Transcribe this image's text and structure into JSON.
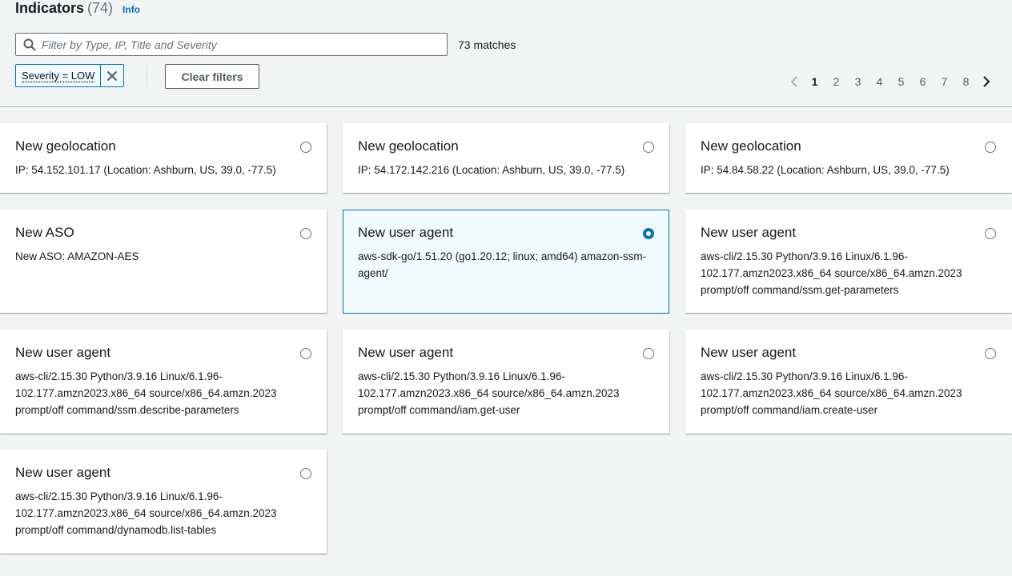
{
  "header": {
    "title": "Indicators",
    "count": "(74)",
    "info": "Info"
  },
  "search": {
    "placeholder": "Filter by Type, IP, Title and Severity",
    "matches": "73 matches"
  },
  "filter_token": {
    "label": "Severity = LOW"
  },
  "clear_filters": "Clear filters",
  "pagination": {
    "pages": [
      "1",
      "2",
      "3",
      "4",
      "5",
      "6",
      "7",
      "8"
    ],
    "current": "1"
  },
  "cards": [
    {
      "title": "New geolocation",
      "description": "IP: 54.152.101.17 (Location: Ashburn, US, 39.0, -77.5)",
      "selected": false
    },
    {
      "title": "New geolocation",
      "description": "IP: 54.172.142.216 (Location: Ashburn, US, 39.0, -77.5)",
      "selected": false
    },
    {
      "title": "New geolocation",
      "description": "IP: 54.84.58.22 (Location: Ashburn, US, 39.0, -77.5)",
      "selected": false
    },
    {
      "title": "New ASO",
      "description": "New ASO: AMAZON-AES",
      "selected": false
    },
    {
      "title": "New user agent",
      "description": "aws-sdk-go/1.51.20 (go1.20.12; linux; amd64) amazon-ssm-agent/",
      "selected": true
    },
    {
      "title": "New user agent",
      "description": "aws-cli/2.15.30 Python/3.9.16 Linux/6.1.96-102.177.amzn2023.x86_64 source/x86_64.amzn.2023 prompt/off command/ssm.get-parameters",
      "selected": false
    },
    {
      "title": "New user agent",
      "description": "aws-cli/2.15.30 Python/3.9.16 Linux/6.1.96-102.177.amzn2023.x86_64 source/x86_64.amzn.2023 prompt/off command/ssm.describe-parameters",
      "selected": false
    },
    {
      "title": "New user agent",
      "description": "aws-cli/2.15.30 Python/3.9.16 Linux/6.1.96-102.177.amzn2023.x86_64 source/x86_64.amzn.2023 prompt/off command/iam.get-user",
      "selected": false
    },
    {
      "title": "New user agent",
      "description": "aws-cli/2.15.30 Python/3.9.16 Linux/6.1.96-102.177.amzn2023.x86_64 source/x86_64.amzn.2023 prompt/off command/iam.create-user",
      "selected": false
    },
    {
      "title": "New user agent",
      "description": "aws-cli/2.15.30 Python/3.9.16 Linux/6.1.96-102.177.amzn2023.x86_64 source/x86_64.amzn.2023 prompt/off command/dynamodb.list-tables",
      "selected": false
    }
  ],
  "colors": {
    "accent": "#0073bb",
    "background": "#f2f3f3",
    "selected_bg": "#f1faff"
  }
}
